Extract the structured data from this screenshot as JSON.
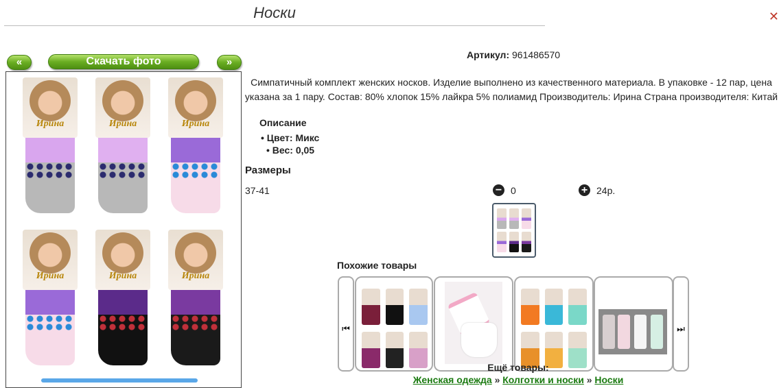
{
  "page": {
    "title": "Носки"
  },
  "gallery": {
    "prev_label": "«",
    "download_label": "Скачать фото",
    "next_label": "»",
    "sock_brand": "Ирина",
    "sock_colors": [
      {
        "band": "#d9a6ee",
        "leg": "#b8b8b8",
        "flowers": "#2b2b6e"
      },
      {
        "band": "#e0b0f0",
        "leg": "#b8b8b8",
        "flowers": "#2b2b6e"
      },
      {
        "band": "#9a6ad8",
        "leg": "#f7dbe8",
        "flowers": "#2a8ad8"
      },
      {
        "band": "#9a6ad8",
        "leg": "#f7dbe8",
        "flowers": "#2a8ad8"
      },
      {
        "band": "#5b2b8a",
        "leg": "#111111",
        "flowers": "#c0303a"
      },
      {
        "band": "#7a3aa0",
        "leg": "#1a1a1a",
        "flowers": "#c0303a"
      }
    ]
  },
  "product": {
    "article_label": "Артикул:",
    "article_value": "961486570",
    "description": "Симпатичный комплект женских носков. Изделие выполнено из качественного материала. В упаковке - 12 пар, цена указана за 1 пару. Состав: 80% хлопок 15% лайкра 5% полиамид Производитель: Ирина Страна производителя: Китай",
    "specs_title": "Описание",
    "specs": [
      "Цвет: Микс",
      "Вес: 0,05"
    ],
    "sizes_title": "Размеры",
    "size": "37-41",
    "quantity": "0",
    "price": "24р."
  },
  "similar": {
    "title": "Похожие товары",
    "left_arrow": "⏮",
    "right_arrow": "⏭"
  },
  "more": {
    "title": "Ещё товары:",
    "crumbs": [
      "Женская одежда",
      "Колготки и носки",
      "Носки"
    ],
    "separator": "»"
  },
  "colors": {
    "accent_green": "#6aae22",
    "link_green": "#1a7a10"
  }
}
